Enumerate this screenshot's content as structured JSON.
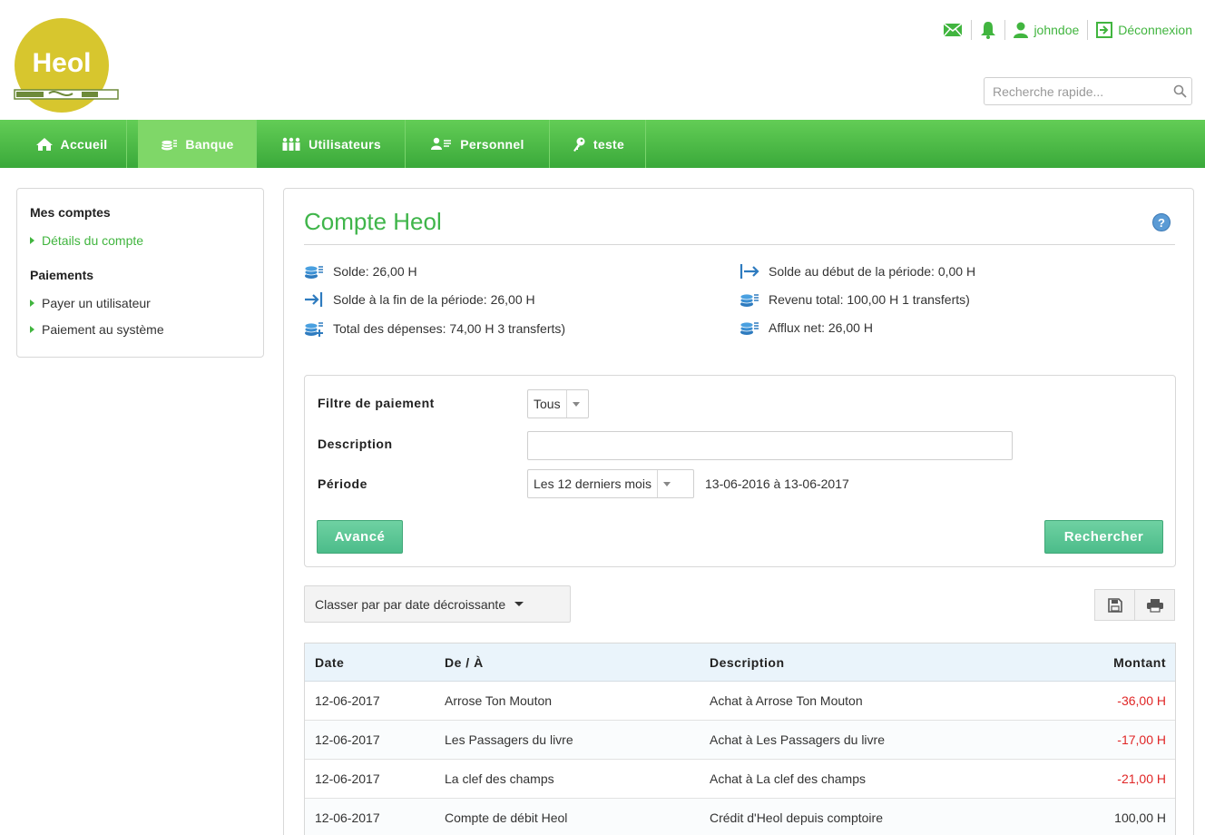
{
  "header": {
    "logo_text": "Heol",
    "username": "johndoe",
    "logout": "Déconnexion",
    "search_placeholder": "Recherche rapide..."
  },
  "nav": [
    {
      "label": "Accueil",
      "icon": "home-icon"
    },
    {
      "label": "Banque",
      "icon": "coins-icon",
      "active": true
    },
    {
      "label": "Utilisateurs",
      "icon": "users-icon"
    },
    {
      "label": "Personnel",
      "icon": "person-list-icon"
    },
    {
      "label": "teste",
      "icon": "key-icon"
    }
  ],
  "sidebar": {
    "section1": "Mes comptes",
    "item1": "Détails du compte",
    "section2": "Paiements",
    "item2": "Payer un utilisateur",
    "item3": "Paiement au système"
  },
  "main": {
    "title": "Compte Heol",
    "help": "?",
    "stats": {
      "solde": "Solde: 26,00 H",
      "solde_fin": "Solde à la fin de la période: 26,00 H",
      "depenses": "Total des dépenses: 74,00 H 3 transferts)",
      "solde_debut": "Solde au début de la période: 0,00 H",
      "revenu": "Revenu total: 100,00 H 1 transferts)",
      "afflux": "Afflux net: 26,00 H"
    }
  },
  "filter": {
    "payment_filter_label": "Filtre de paiement",
    "payment_filter_value": "Tous",
    "description_label": "Description",
    "description_value": "",
    "period_label": "Période",
    "period_value": "Les 12 derniers mois",
    "period_range": "13-06-2016 à 13-06-2017",
    "advanced": "Avancé",
    "search": "Rechercher"
  },
  "sort": {
    "label": "Classer par par date décroissante"
  },
  "table": {
    "headers": [
      "Date",
      "De / À",
      "Description",
      "Montant"
    ],
    "rows": [
      {
        "date": "12-06-2017",
        "from": "Arrose Ton Mouton",
        "desc": "Achat à Arrose Ton Mouton",
        "amount": "-36,00 H"
      },
      {
        "date": "12-06-2017",
        "from": "Les Passagers du livre",
        "desc": "Achat à Les Passagers du livre",
        "amount": "-17,00 H"
      },
      {
        "date": "12-06-2017",
        "from": "La clef des champs",
        "desc": "Achat à La clef des champs",
        "amount": "-21,00 H"
      },
      {
        "date": "12-06-2017",
        "from": "Compte de débit Heol",
        "desc": "Crédit d'Heol depuis comptoire",
        "amount": "100,00 H"
      }
    ]
  },
  "colors": {
    "brand_green": "#41b53f",
    "nav_green": "#4cbb45",
    "button_teal": "#5cc596",
    "negative_red": "#e02626",
    "logo_yellow": "#d7c62e"
  }
}
